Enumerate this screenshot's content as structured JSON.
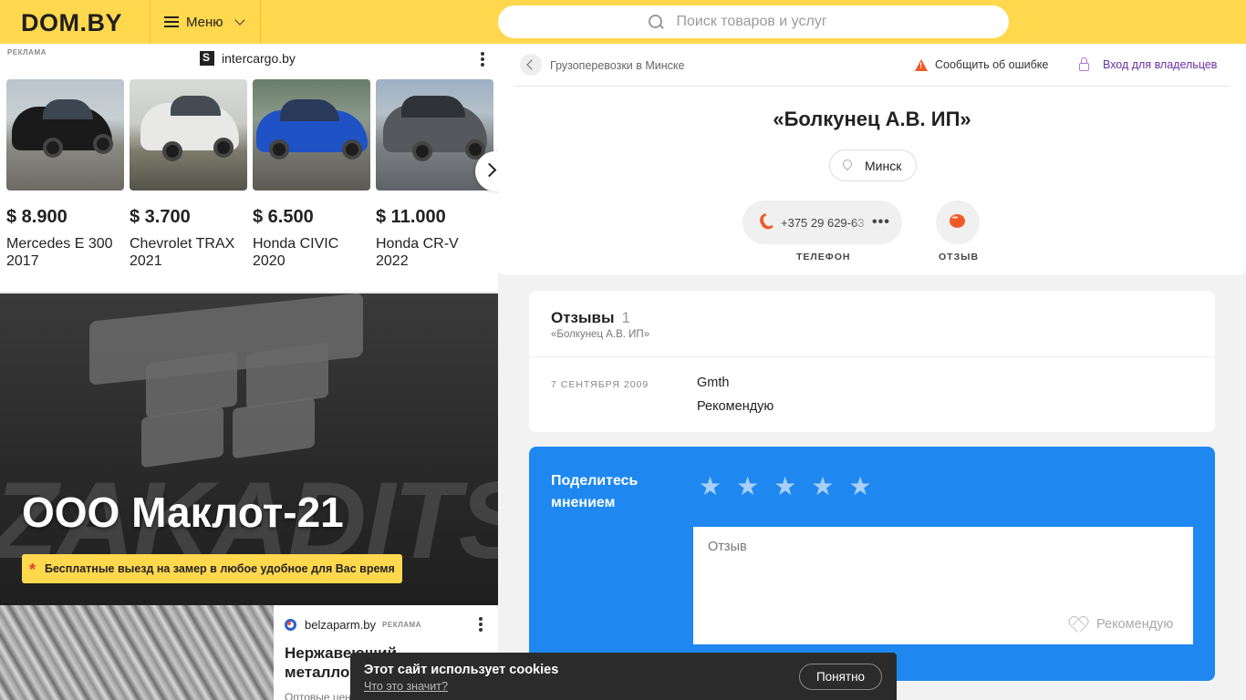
{
  "header": {
    "logo": "DOM.BY",
    "menu_label": "Меню",
    "search_placeholder": "Поиск товаров и услуг"
  },
  "ad_cars": {
    "tag": "РЕКЛАМА",
    "source": "intercargo.by",
    "items": [
      {
        "price": "$ 8.900",
        "name": "Mercedes E 300 2017",
        "icon": "car-photo"
      },
      {
        "price": "$ 3.700",
        "name": "Chevrolet TRAX 2021",
        "icon": "car-photo"
      },
      {
        "price": "$ 6.500",
        "name": "Honda CIVIC 2020",
        "icon": "car-photo"
      },
      {
        "price": "$ 11.000",
        "name": "Honda CR-V 2022",
        "icon": "car-photo"
      }
    ]
  },
  "banner": {
    "title": "ООО Маклот-21",
    "promo": "Бесплатные выезд на замер в любое удобное для Вас время",
    "bg_text": "ZAKADITSKY"
  },
  "ad_metal": {
    "source": "belzaparm.by",
    "tag": "РЕКЛАМА",
    "headline": "Нержавеющий металлопрокат",
    "subtitle": "Оптовые цены"
  },
  "company": {
    "breadcrumb": "Грузоперевозки в Минске",
    "report_label": "Сообщить об ошибке",
    "owner_label": "Вход для владельцев",
    "title": "«Болкунец А.В. ИП»",
    "city": "Минск",
    "phone": "+375 29 629-63",
    "phone_label": "ТЕЛЕФОН",
    "review_label": "ОТЗЫВ",
    "accent_color": "#f05a28"
  },
  "reviews": {
    "title": "Отзывы",
    "count": "1",
    "subtitle": "«Болкунец А.В. ИП»",
    "items": [
      {
        "date": "7 СЕНТЯБРЯ 2009",
        "author": "Gmth",
        "text": "Рекомендую"
      }
    ]
  },
  "opinion": {
    "label": "Поделитесь мнением",
    "rating_stars": 5,
    "rating_value": 0,
    "textarea_placeholder": "Отзыв",
    "recommend_label": "Рекомендую",
    "bg_color": "#1e88f0"
  },
  "cookie": {
    "message": "Этот сайт использует cookies",
    "link": "Что это значит?",
    "button": "Понятно"
  }
}
